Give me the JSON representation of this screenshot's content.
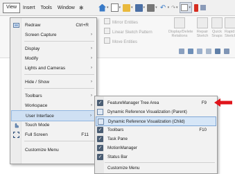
{
  "menubar": {
    "items": [
      "View",
      "Insert",
      "Tools",
      "Window"
    ],
    "pin_icon": "pin-icon"
  },
  "toolbar_icons": [
    "home-icon",
    "new-doc-icon",
    "open-icon",
    "save-icon",
    "print-icon",
    "undo-icon",
    "select-icon",
    "rebuild-icon",
    "options-icon"
  ],
  "ribbon": {
    "mirror_entities": "Mirror Entities",
    "linear_sketch_pattern": "Linear Sketch Pattern",
    "move_entities": "Move Entities",
    "display_delete_relations": "Display/Delete Relations",
    "repair_sketch": "Repair Sketch",
    "quick_snaps": "Quick Snaps",
    "rapid_sketch": "Rapid Sketch"
  },
  "view_menu": {
    "items": [
      {
        "label": "Redraw",
        "shortcut": "Ctrl+R",
        "icon": "redraw-icon"
      },
      {
        "label": "Screen Capture",
        "submenu": true
      },
      {
        "label": "Display",
        "submenu": true
      },
      {
        "label": "Modify",
        "submenu": true
      },
      {
        "label": "Lights and Cameras",
        "submenu": true
      },
      {
        "label": "Hide / Show",
        "submenu": true
      },
      {
        "label": "Toolbars",
        "submenu": true
      },
      {
        "label": "Workspace",
        "submenu": true
      },
      {
        "label": "User Interface",
        "submenu": true,
        "highlighted": true
      },
      {
        "label": "Touch Mode",
        "icon": "touch-icon"
      },
      {
        "label": "Full Screen",
        "shortcut": "F11",
        "icon": "fullscreen-icon"
      },
      {
        "label": "Customize Menu"
      }
    ]
  },
  "submenu": {
    "items": [
      {
        "label": "FeatureManager Tree Area",
        "shortcut": "F9",
        "checked": true
      },
      {
        "label": "Dynamic Reference Visualization (Parent)",
        "icon": "parent-ref-icon"
      },
      {
        "label": "Dynamic Reference Visualization (Child)",
        "icon": "child-ref-icon",
        "highlighted": true
      },
      {
        "label": "Toolbars",
        "shortcut": "F10",
        "checked": true
      },
      {
        "label": "Task Pane",
        "checked": true
      },
      {
        "label": "MotionManager",
        "checked": true
      },
      {
        "label": "Status Bar",
        "checked": true
      },
      {
        "label": "Customize Menu"
      }
    ]
  },
  "colors": {
    "highlight": "#cfe0f3",
    "arrow": "#e0141b",
    "check": "#4a5d73"
  }
}
